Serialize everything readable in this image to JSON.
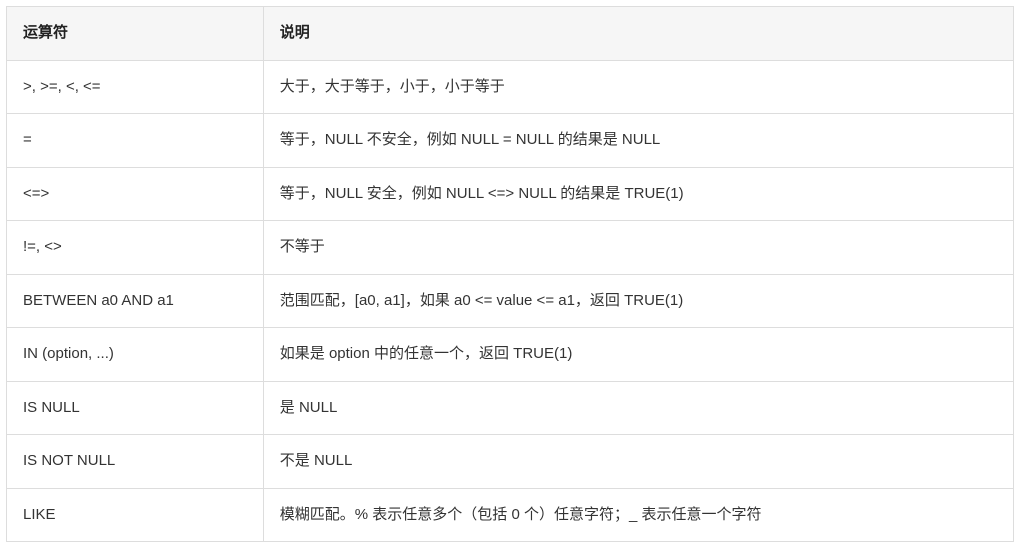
{
  "table": {
    "headers": {
      "operator": "运算符",
      "description": "说明"
    },
    "rows": [
      {
        "operator": ">, >=, <, <=",
        "description": "大于，大于等于，小于，小于等于"
      },
      {
        "operator": "=",
        "description": "等于，NULL 不安全，例如 NULL = NULL 的结果是 NULL"
      },
      {
        "operator": "<=>",
        "description": "等于，NULL 安全，例如 NULL <=> NULL 的结果是 TRUE(1)"
      },
      {
        "operator": "!=, <>",
        "description": "不等于"
      },
      {
        "operator": "BETWEEN a0 AND a1",
        "description": "范围匹配，[a0, a1]，如果 a0 <= value <= a1，返回 TRUE(1)"
      },
      {
        "operator": "IN (option, ...)",
        "description": "如果是 option 中的任意一个，返回 TRUE(1)"
      },
      {
        "operator": "IS NULL",
        "description": "是 NULL"
      },
      {
        "operator": "IS NOT NULL",
        "description": "不是 NULL"
      },
      {
        "operator": "LIKE",
        "description": "模糊匹配。% 表示任意多个（包括 0 个）任意字符；_ 表示任意一个字符"
      }
    ]
  }
}
